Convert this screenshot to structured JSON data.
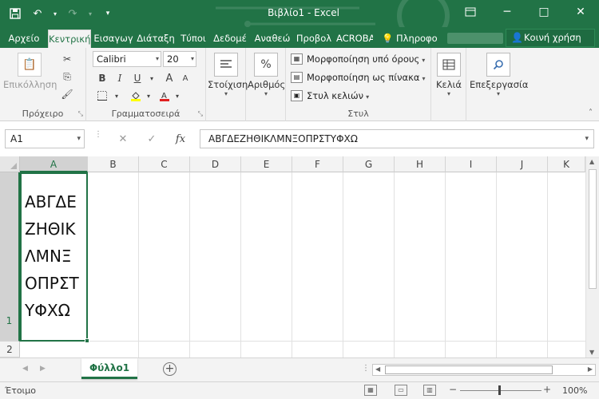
{
  "titlebar": {
    "title": "Βιβλίο1 - Excel",
    "qat": {
      "save_icon": "save-icon",
      "undo_icon": "undo-icon",
      "redo_icon": "redo-icon",
      "customize_icon": "chevron-down-icon"
    },
    "controls": {
      "minimize": "─",
      "restore": "❐",
      "restore_ribbon": "□",
      "close": "✕"
    }
  },
  "tabs": [
    {
      "label": "Αρχείο",
      "active": false
    },
    {
      "label": "Κεντρική",
      "active": true
    },
    {
      "label": "Εισαγωγ",
      "active": false
    },
    {
      "label": "Διάταξη",
      "active": false
    },
    {
      "label": "Τύποι",
      "active": false
    },
    {
      "label": "Δεδομέ",
      "active": false
    },
    {
      "label": "Αναθεώ",
      "active": false
    },
    {
      "label": "Προβολ",
      "active": false
    },
    {
      "label": "ACROBA",
      "active": false
    }
  ],
  "tell_me": "Πληροφο",
  "share": "Κοινή χρήση",
  "ribbon": {
    "clipboard": {
      "label": "Πρόχειρο",
      "paste": "Επικόλληση"
    },
    "font": {
      "label": "Γραμματοσειρά",
      "name": "Calibri",
      "size": "20",
      "bold": "B",
      "italic": "I",
      "underline": "U",
      "grow": "A",
      "shrink": "A"
    },
    "alignment": {
      "label": "Στοίχιση"
    },
    "number": {
      "label": "Αριθμός",
      "symbol": "%"
    },
    "styles": {
      "label": "Στυλ",
      "conditional": "Μορφοποίηση υπό όρους",
      "as_table": "Μορφοποίηση ως πίνακα",
      "cell_styles": "Στυλ κελιών"
    },
    "cells": {
      "label": "Κελιά"
    },
    "editing": {
      "label": "Επεξεργασία"
    }
  },
  "formula_bar": {
    "name_box": "A1",
    "cancel": "✕",
    "enter": "✓",
    "fx": "fx",
    "value": "ΑΒΓΔΕΖΗΘΙΚΛΜΝΞΟΠΡΣΤΥΦΧΩ"
  },
  "grid": {
    "columns": [
      "A",
      "B",
      "C",
      "D",
      "E",
      "F",
      "G",
      "H",
      "I",
      "J",
      "K"
    ],
    "rows": [
      "1",
      "2"
    ],
    "selected_cell": "A1",
    "a1_text": "ΑΒΓΔΕ\nΖΗΘΙΚ\nΛΜΝΞ\nΟΠΡΣΤ\nΥΦΧΩ"
  },
  "sheets": {
    "active": "Φύλλο1",
    "add": "+"
  },
  "status": {
    "ready": "Έτοιμο",
    "zoom": "100%",
    "zoom_minus": "−",
    "zoom_plus": "+"
  },
  "colors": {
    "accent": "#217346",
    "ribbon_bg": "#f3f3f3"
  }
}
